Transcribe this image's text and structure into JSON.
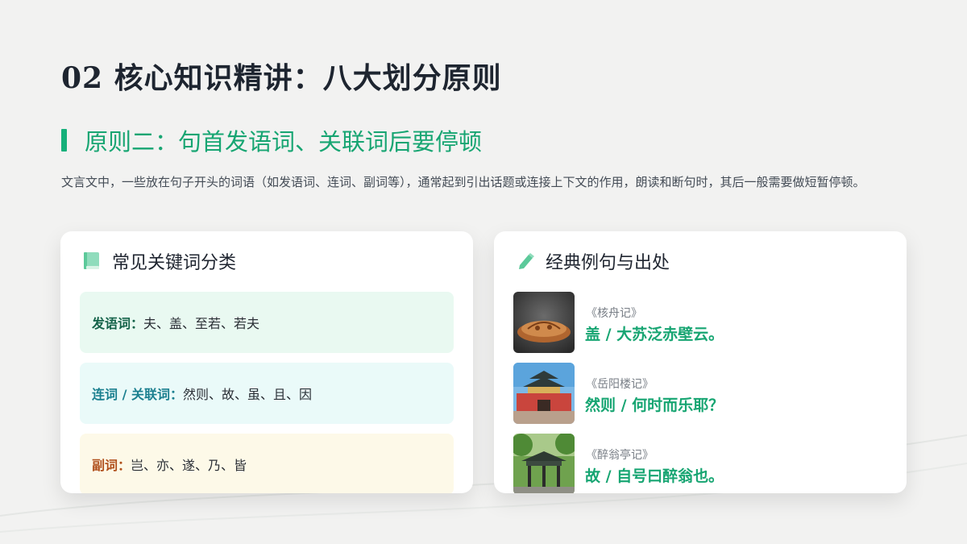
{
  "slide": {
    "title": "02 核心知识精讲：八大划分原则"
  },
  "section": {
    "title": "原则二：句首发语词、关联词后要停顿",
    "intro": "文言文中，一些放在句子开头的词语（如发语词、连词、副词等），通常起到引出话题或连接上下文的作用，朗读和断句时，其后一般需要做短暂停顿。",
    "accent_color": "#16b07a"
  },
  "left_card": {
    "title": "常见关键词分类",
    "icon": "book-icon",
    "categories": [
      {
        "label": "发语词：",
        "words": "夫、盖、至若、若夫",
        "label_color": "#15634a",
        "bg_color": "#e9f9f1"
      },
      {
        "label": "连词 / 关联词：",
        "words": "然则、故、虽、且、因",
        "label_color": "#1a7f8f",
        "bg_color": "#eafaf9"
      },
      {
        "label": "副词：",
        "words": "岂、亦、遂、乃、皆",
        "label_color": "#b0501c",
        "bg_color": "#fdf9e8"
      }
    ]
  },
  "right_card": {
    "title": "经典例句与出处",
    "icon": "pencil-icon",
    "examples": [
      {
        "source": "《核舟记》",
        "sentence": "盖 / 大苏泛赤壁云。",
        "image": "carved-walnut-boat-photo"
      },
      {
        "source": "《岳阳楼记》",
        "sentence": "然则 / 何时而乐耶？",
        "image": "yueyang-tower-photo"
      },
      {
        "source": "《醉翁亭记》",
        "sentence": "故 / 自号曰醉翁也。",
        "image": "zuiweng-pavilion-photo"
      }
    ]
  }
}
